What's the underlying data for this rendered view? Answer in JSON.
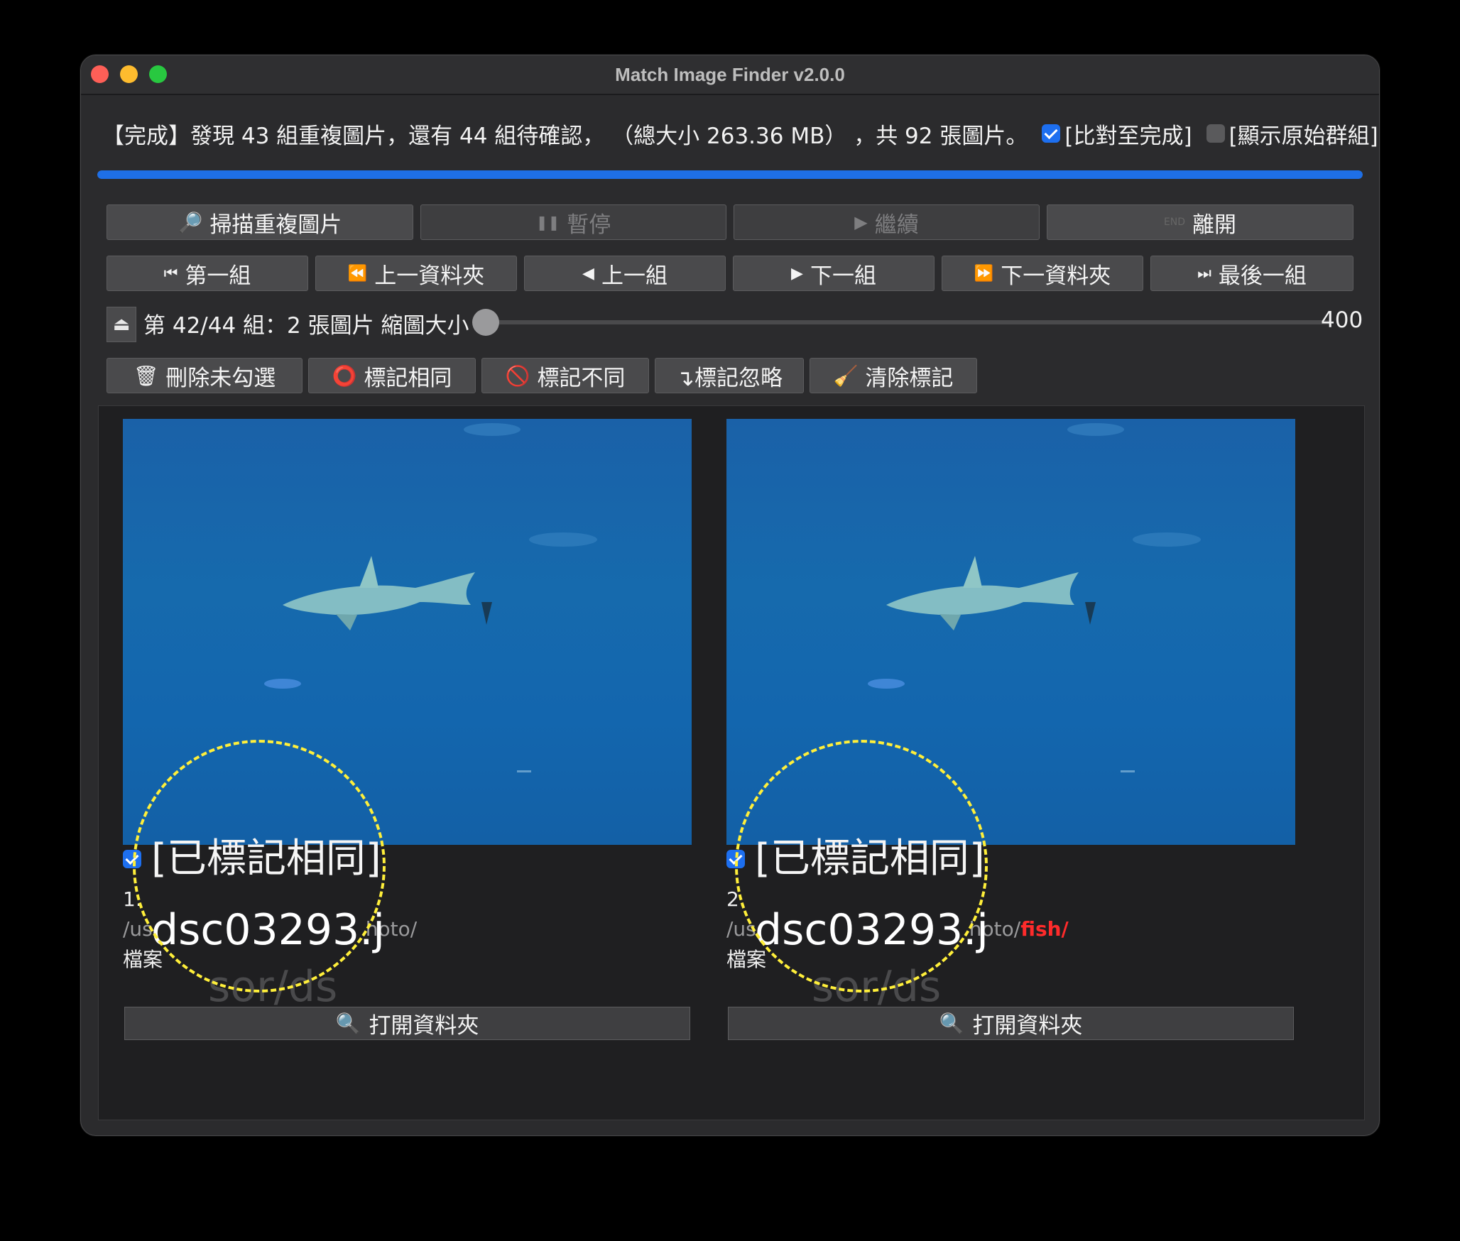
{
  "window": {
    "title": "Match Image Finder v2.0.0"
  },
  "status": {
    "message": "【完成】發現 43 組重複圖片，還有 44 組待確認， （總大小 263.36 MB） ，共 92 張圖片。",
    "compare_to_done_label": "[比對至完成]",
    "compare_to_done_checked": true,
    "show_original_groups_label": "[顯示原始群組]",
    "show_original_groups_checked": false,
    "progress": 1.0
  },
  "toolbar1": {
    "scan": "掃描重複圖片",
    "pause": "暫停",
    "resume": "繼續",
    "exit": "離開"
  },
  "toolbar2": {
    "first": "第一組",
    "prev_folder": "上一資料夾",
    "prev": "上一組",
    "next": "下一組",
    "next_folder": "下一資料夾",
    "last": "最後一組"
  },
  "group": {
    "label": "第 42/44 組：2 張圖片 縮圖大小",
    "thumb_size": "400"
  },
  "toolbar3": {
    "delete_unchecked": "刪除未勾選",
    "mark_same": "標記相同",
    "mark_diff": "標記不同",
    "mark_ignore": "↴標記忽略",
    "clear_marks": "清除標記"
  },
  "cards": [
    {
      "checked": true,
      "mark": "[已標記相同]",
      "index": "1.",
      "filename": "dsc03293.j",
      "path_pre": "/us",
      "path_post": "hoto/",
      "path_red": "",
      "file_label": "檔案",
      "ghost": "sor/ds",
      "open": "打開資料夾"
    },
    {
      "checked": true,
      "mark": "[已標記相同]",
      "index": "2.",
      "filename": "dsc03293.j",
      "path_pre": "/us",
      "path_post": "hoto/",
      "path_red": "fish/",
      "file_label": "檔案",
      "ghost": "sor/ds",
      "open": "打開資料夾"
    }
  ],
  "icons": {
    "scan": "magnifier-icon",
    "pause": "pause-icon",
    "resume": "play-icon",
    "exit": "end-icon",
    "trash": "trash-icon",
    "same": "circle-icon",
    "diff": "prohibited-icon",
    "broom": "broom-icon",
    "open": "search-icon"
  },
  "colors": {
    "accent": "#1e6fe6",
    "red_path": "#ff2b2b",
    "highlight": "#ffef3a"
  }
}
